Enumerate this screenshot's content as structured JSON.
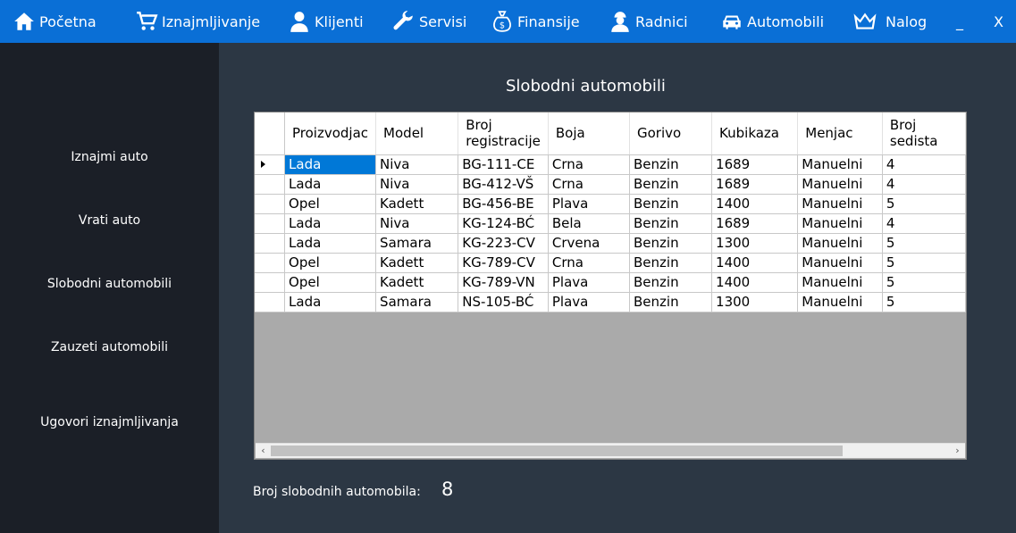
{
  "nav": {
    "items": [
      {
        "label": "Početna",
        "icon": "home-icon"
      },
      {
        "label": "Iznajmljivanje",
        "icon": "cart-icon"
      },
      {
        "label": "Klijenti",
        "icon": "user-icon"
      },
      {
        "label": "Servisi",
        "icon": "wrench-icon"
      },
      {
        "label": "Finansije",
        "icon": "money-bag-icon"
      },
      {
        "label": "Radnici",
        "icon": "worker-icon"
      },
      {
        "label": "Automobili",
        "icon": "car-icon"
      },
      {
        "label": "Nalog",
        "icon": "crown-icon"
      }
    ],
    "minimize": "_",
    "close": "X"
  },
  "sidebar": {
    "items": [
      {
        "label": "Iznajmi auto"
      },
      {
        "label": "Vrati auto"
      },
      {
        "label": "Slobodni automobili"
      },
      {
        "label": "Zauzeti automobili"
      },
      {
        "label": "Ugovori iznajmljivanja"
      }
    ]
  },
  "main": {
    "title": "Slobodni automobili",
    "table": {
      "columns": [
        "Proizvodjac",
        "Model",
        "Broj registracije",
        "Boja",
        "Gorivo",
        "Kubikaza",
        "Menjac",
        "Broj sedista"
      ],
      "rows": [
        [
          "Lada",
          "Niva",
          "BG-111-CE",
          "Crna",
          "Benzin",
          "1689",
          "Manuelni",
          "4"
        ],
        [
          "Lada",
          "Niva",
          "BG-412-VŠ",
          "Crna",
          "Benzin",
          "1689",
          "Manuelni",
          "4"
        ],
        [
          "Opel",
          "Kadett",
          "BG-456-BE",
          "Plava",
          "Benzin",
          "1400",
          "Manuelni",
          "5"
        ],
        [
          "Lada",
          "Niva",
          "KG-124-BĆ",
          "Bela",
          "Benzin",
          "1689",
          "Manuelni",
          "4"
        ],
        [
          "Lada",
          "Samara",
          "KG-223-CV",
          "Crvena",
          "Benzin",
          "1300",
          "Manuelni",
          "5"
        ],
        [
          "Opel",
          "Kadett",
          "KG-789-CV",
          "Crna",
          "Benzin",
          "1400",
          "Manuelni",
          "5"
        ],
        [
          "Opel",
          "Kadett",
          "KG-789-VN",
          "Plava",
          "Benzin",
          "1400",
          "Manuelni",
          "5"
        ],
        [
          "Lada",
          "Samara",
          "NS-105-BĆ",
          "Plava",
          "Benzin",
          "1300",
          "Manuelni",
          "5"
        ]
      ]
    },
    "count_label": "Broj slobodnih automobila:",
    "count_value": "8"
  },
  "colors": {
    "topbar": "#0a6fd6",
    "sidebar": "#1b1f27",
    "main_bg": "#2c3744",
    "selection": "#0078d7"
  }
}
